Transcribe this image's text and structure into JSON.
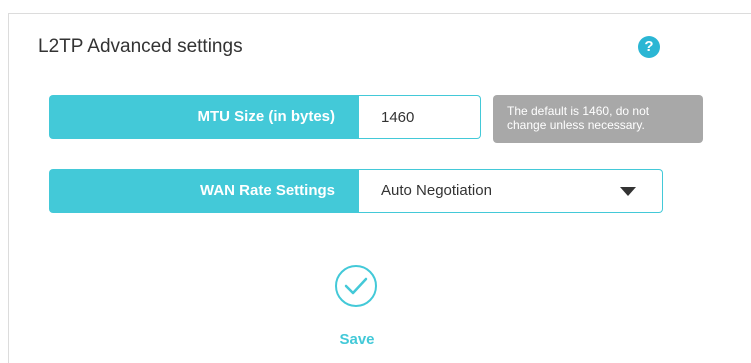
{
  "section": {
    "title": "L2TP Advanced settings"
  },
  "help": {
    "icon_glyph": "?"
  },
  "mtu": {
    "label": "MTU Size (in bytes)",
    "value": "1460",
    "hint": "The default is 1460, do not change unless necessary."
  },
  "wan_rate": {
    "label": "WAN Rate Settings",
    "selected": "Auto Negotiation"
  },
  "save": {
    "label": "Save"
  },
  "colors": {
    "accent": "#43c9d8",
    "help": "#2bb6d4",
    "tooltip_bg": "#a8a8a8"
  },
  "icons": {
    "help": "help-icon",
    "dropdown": "chevron-down-icon",
    "save": "check-circle-icon"
  }
}
